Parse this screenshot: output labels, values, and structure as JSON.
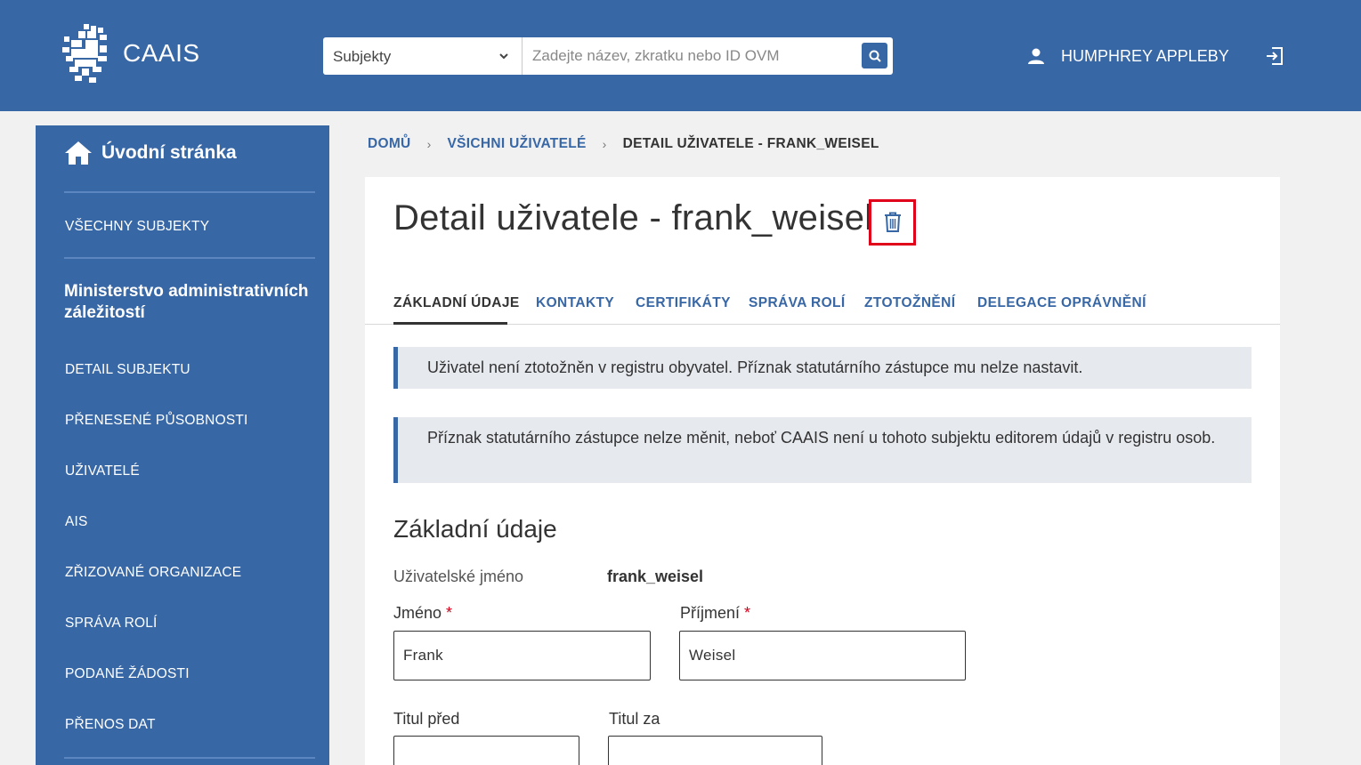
{
  "header": {
    "brand": "CAAIS",
    "search_select": "Subjekty",
    "search_placeholder": "Zadejte název, zkratku nebo ID OVM",
    "user_name": "HUMPHREY APPLEBY"
  },
  "sidebar": {
    "home": "Úvodní stránka",
    "all_subjects": "VŠECHNY SUBJEKTY",
    "org_name": "Ministerstvo administrativních záležitostí",
    "items": [
      {
        "label": "DETAIL SUBJEKTU"
      },
      {
        "label": "PŘENESENÉ PŮSOBNOSTI"
      },
      {
        "label": "UŽIVATELÉ"
      },
      {
        "label": "AIS"
      },
      {
        "label": "ZŘIZOVANÉ ORGANIZACE"
      },
      {
        "label": "SPRÁVA ROLÍ"
      },
      {
        "label": "PODANÉ ŽÁDOSTI"
      },
      {
        "label": "PŘENOS DAT"
      }
    ]
  },
  "breadcrumb": {
    "home": "DOMŮ",
    "users": "VŠICHNI UŽIVATELÉ",
    "current": "DETAIL UŽIVATELE - FRANK_WEISEL"
  },
  "main": {
    "title": "Detail uživatele - frank_weisel",
    "tabs": [
      {
        "label": "ZÁKLADNÍ ÚDAJE"
      },
      {
        "label": "KONTAKTY"
      },
      {
        "label": "CERTIFIKÁTY"
      },
      {
        "label": "SPRÁVA ROLÍ"
      },
      {
        "label": "ZTOTOŽNĚNÍ"
      },
      {
        "label": "DELEGACE OPRÁVNĚNÍ"
      }
    ],
    "alerts": [
      "Uživatel není ztotožněn v registru obyvatel. Příznak statutárního zástupce mu nelze nastavit.",
      "Příznak statutárního zástupce nelze měnit, neboť CAAIS není u tohoto subjektu editorem údajů v registru osob."
    ],
    "section_title": "Základní údaje",
    "username_label": "Uživatelské jméno",
    "username_value": "frank_weisel",
    "first_name_label": "Jméno",
    "first_name_value": "Frank",
    "last_name_label": "Příjmení",
    "last_name_value": "Weisel",
    "required_mark": "*",
    "title_before_label": "Titul před",
    "title_after_label": "Titul za",
    "title_before_value": "",
    "title_after_value": ""
  },
  "colors": {
    "brand_blue": "#3867a6",
    "highlight_red": "#e1001a"
  }
}
